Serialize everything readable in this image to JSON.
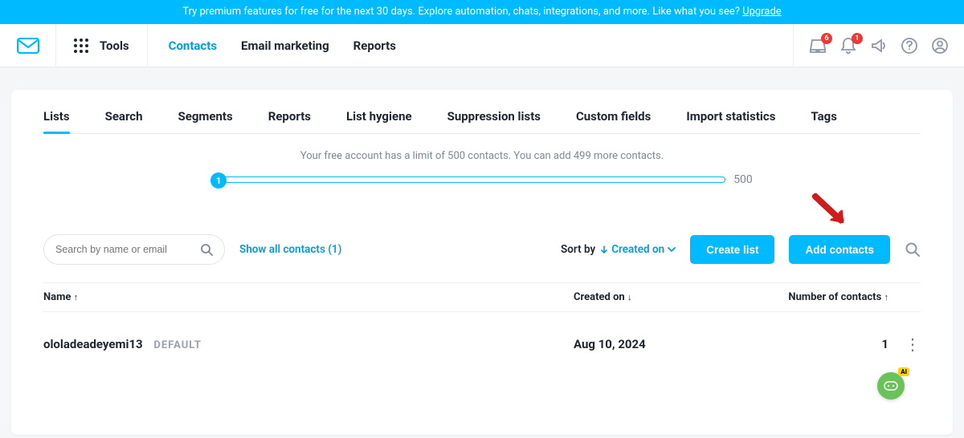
{
  "promo": {
    "text": "Try premium features for free for the next 30 days. Explore automation, chats, integrations, and more. Like what you see? ",
    "link": "Upgrade"
  },
  "header": {
    "tools": "Tools",
    "nav": {
      "contacts": "Contacts",
      "email_marketing": "Email marketing",
      "reports": "Reports"
    },
    "badges": {
      "inbox": "6",
      "bell": "1"
    }
  },
  "subtabs": {
    "lists": "Lists",
    "search": "Search",
    "segments": "Segments",
    "reports": "Reports",
    "list_hygiene": "List hygiene",
    "suppression": "Suppression lists",
    "custom_fields": "Custom fields",
    "import_stats": "Import statistics",
    "tags": "Tags"
  },
  "limit": {
    "text": "Your free account has a limit of 500 contacts. You can add 499 more contacts.",
    "current": "1",
    "max": "500"
  },
  "search": {
    "placeholder": "Search by name or email"
  },
  "show_all": "Show all contacts (1)",
  "sort": {
    "label": "Sort by",
    "value": "Created on"
  },
  "buttons": {
    "create_list": "Create list",
    "add_contacts": "Add contacts"
  },
  "columns": {
    "name": "Name",
    "created": "Created on",
    "count": "Number of contacts"
  },
  "rows": [
    {
      "name": "ololadeadeyemi13",
      "badge": "DEFAULT",
      "created": "Aug 10, 2024",
      "count": "1"
    }
  ],
  "ai": {
    "label": "AI"
  }
}
